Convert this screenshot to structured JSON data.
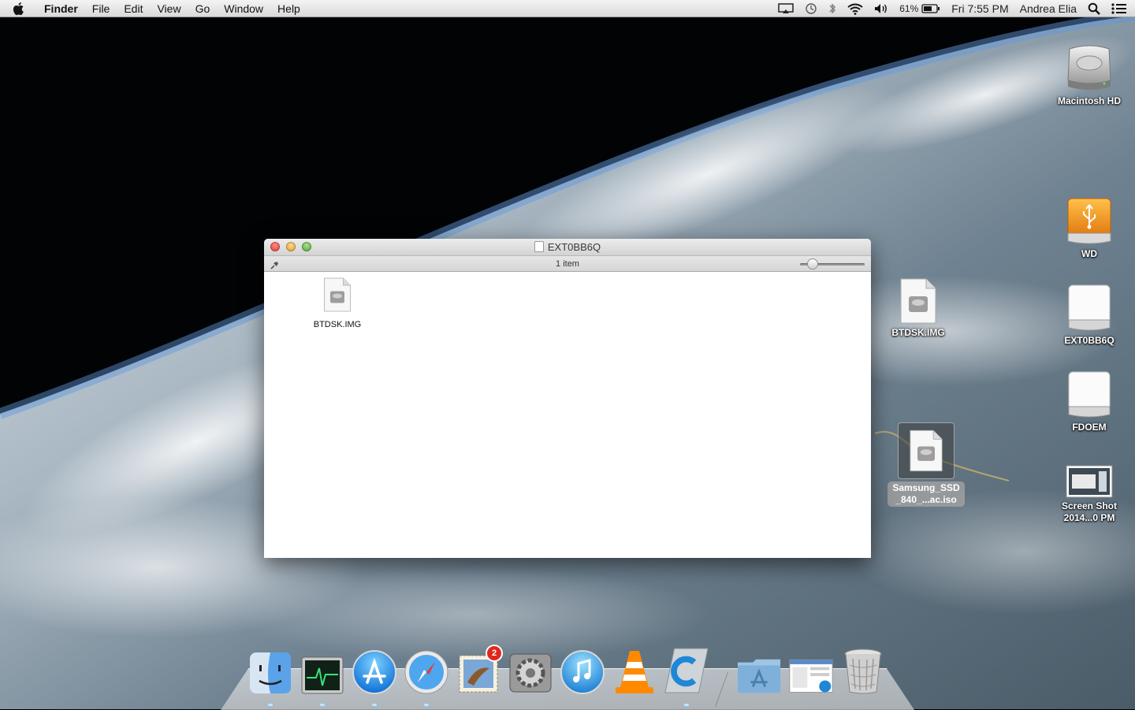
{
  "menubar": {
    "app_name": "Finder",
    "menus": [
      "File",
      "Edit",
      "View",
      "Go",
      "Window",
      "Help"
    ],
    "battery_percent": "61%",
    "clock": "Fri 7:55 PM",
    "user": "Andrea Elia"
  },
  "finder_window": {
    "title": "EXT0BB6Q",
    "status": "1 item",
    "items": [
      {
        "name": "BTDSK.IMG"
      }
    ]
  },
  "desktop_icons": [
    {
      "label": "Macintosh HD",
      "icon": "hard-drive-icon"
    },
    {
      "label": "WD",
      "icon": "usb-drive-icon"
    },
    {
      "label": "BTDSK.IMG",
      "icon": "disk-image-icon"
    },
    {
      "label": "EXT0BB6Q",
      "icon": "external-drive-icon"
    },
    {
      "label": "FDOEM",
      "icon": "external-drive-icon"
    },
    {
      "label": "Samsung_SSD\n_840_...ac.iso",
      "icon": "disk-image-icon",
      "selected": true
    },
    {
      "label": "Screen Shot\n2014...0 PM",
      "icon": "screenshot-icon"
    }
  ],
  "dock": {
    "apps": [
      {
        "name": "Finder",
        "icon": "finder-icon",
        "running": true
      },
      {
        "name": "Activity Monitor",
        "icon": "activity-monitor-icon",
        "running": true
      },
      {
        "name": "App Store",
        "icon": "app-store-icon",
        "running": true
      },
      {
        "name": "Safari",
        "icon": "safari-icon",
        "running": true
      },
      {
        "name": "Mail",
        "icon": "mail-icon",
        "badge": "2",
        "running": false
      },
      {
        "name": "System Preferences",
        "icon": "system-preferences-icon",
        "running": false
      },
      {
        "name": "iTunes",
        "icon": "itunes-icon",
        "running": false
      },
      {
        "name": "VLC",
        "icon": "vlc-icon",
        "running": false
      },
      {
        "name": "Carbon Copy Cloner",
        "icon": "ccc-icon",
        "running": true
      }
    ],
    "folders": [
      {
        "name": "Applications",
        "icon": "applications-folder-icon"
      },
      {
        "name": "Downloads",
        "icon": "downloads-stack-icon"
      },
      {
        "name": "Trash",
        "icon": "trash-icon"
      }
    ]
  },
  "colors": {
    "menubar_bg": "#e6e6e6",
    "close_button": "#d8382f",
    "minimize_button": "#d99b22",
    "zoom_button": "#4f9d32",
    "mail_badge": "#e0281c"
  }
}
